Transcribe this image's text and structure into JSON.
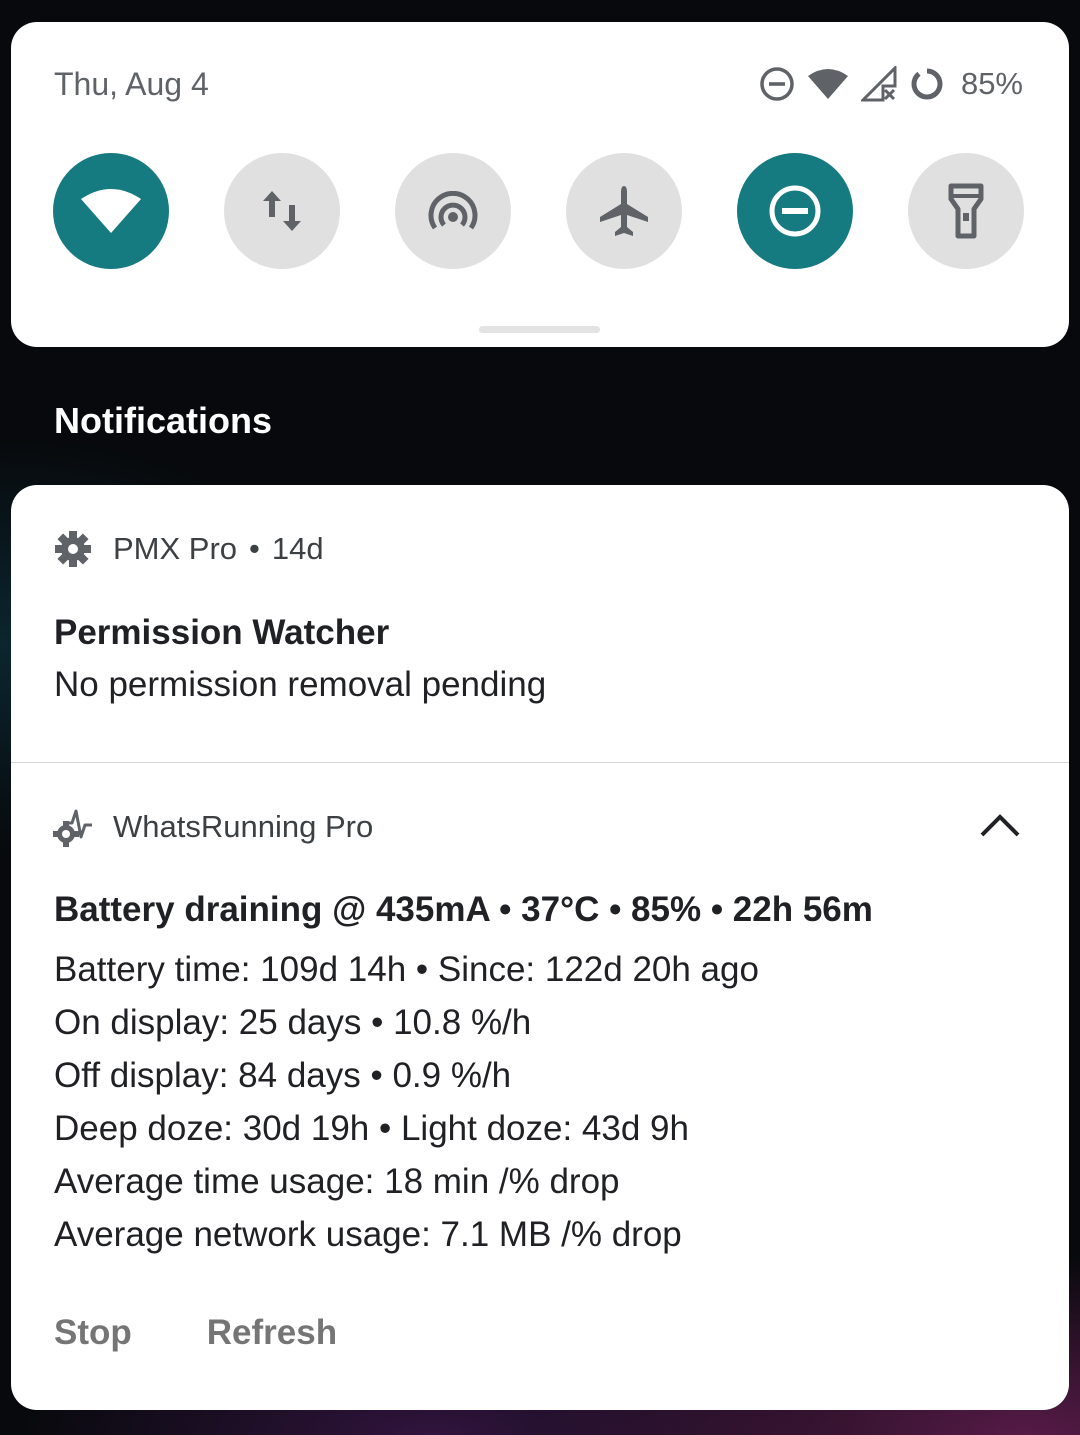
{
  "quick_settings": {
    "date": "Thu, Aug 4",
    "battery_percent": "85%",
    "tiles": [
      {
        "name": "wifi",
        "active": true
      },
      {
        "name": "mobile-data",
        "active": false
      },
      {
        "name": "hotspot",
        "active": false
      },
      {
        "name": "airplane-mode",
        "active": false
      },
      {
        "name": "do-not-disturb",
        "active": true
      },
      {
        "name": "flashlight",
        "active": false
      }
    ],
    "accent_color": "#167b80"
  },
  "notifications_header": "Notifications",
  "notifications": [
    {
      "app": "PMX Pro",
      "time": "14d",
      "icon": "gear-icon",
      "title": "Permission Watcher",
      "text": "No permission removal pending"
    },
    {
      "app": "WhatsRunning Pro",
      "icon": "gear-pulse-icon",
      "title": "Battery draining @ 435mA • 37°C • 85% • 22h 56m",
      "lines": [
        "Battery time: 109d 14h • Since: 122d 20h ago",
        "On display: 25 days • 10.8 %/h",
        "Off display: 84 days • 0.9 %/h",
        "Deep doze: 30d 19h • Light doze: 43d 9h",
        "Average time usage: 18 min /% drop",
        "Average network usage: 7.1 MB /% drop"
      ],
      "actions": [
        "Stop",
        "Refresh"
      ]
    }
  ],
  "separator": "•"
}
